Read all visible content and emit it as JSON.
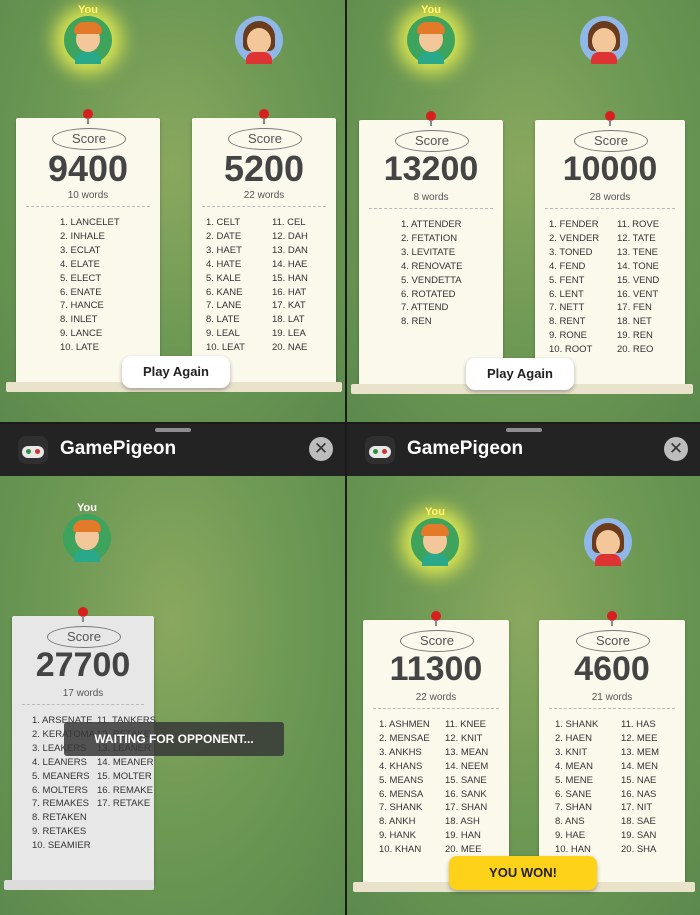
{
  "you_label": "You",
  "panels": [
    {
      "left": {
        "score_label": "Score",
        "score": "9400",
        "words": "10 words",
        "col1": [
          "1. LANCELET",
          "2. INHALE",
          "3. ECLAT",
          "4. ELATE",
          "5. ELECT",
          "6. ENATE",
          "7. HANCE",
          "8. INLET",
          "9. LANCE",
          "10. LATE"
        ]
      },
      "right": {
        "score_label": "Score",
        "score": "5200",
        "words": "22 words",
        "col1": [
          "1. CELT",
          "2. DATE",
          "3. HAET",
          "4. HATE",
          "5. KALE",
          "6. KANE",
          "7. LANE",
          "8. LATE",
          "9. LEAL",
          "10. LEAT"
        ],
        "col2": [
          "11. CEL",
          "12. DAH",
          "13. DAN",
          "14. HAE",
          "15. HAN",
          "16. HAT",
          "17. KAT",
          "18. LAT",
          "19. LEA",
          "20. NAE"
        ]
      },
      "button": "Play Again"
    },
    {
      "left": {
        "score_label": "Score",
        "score": "13200",
        "words": "8 words",
        "col1": [
          "1. ATTENDER",
          "2. FETATION",
          "3. LEVITATE",
          "4. RENOVATE",
          "5. VENDETTA",
          "6. ROTATED",
          "7. ATTEND",
          "8. REN"
        ]
      },
      "right": {
        "score_label": "Score",
        "score": "10000",
        "words": "28 words",
        "col1": [
          "1. FENDER",
          "2. VENDER",
          "3. TONED",
          "4. FEND",
          "5. FENT",
          "6. LENT",
          "7. NETT",
          "8. RENT",
          "9. RONE",
          "10. ROOT"
        ],
        "col2": [
          "11. ROVE",
          "12. TATE",
          "13. TENE",
          "14. TONE",
          "15. VEND",
          "16. VENT",
          "17. FEN",
          "18. NET",
          "19. REN",
          "20. REO"
        ]
      },
      "button": "Play Again"
    },
    {
      "header": {
        "title": "GamePigeon",
        "close": "✕"
      },
      "left": {
        "score_label": "Score",
        "score": "27700",
        "words": "17 words",
        "col1": [
          "1. ARSENATE",
          "2. KERATOMA",
          "3. LEAKERS",
          "4. LEANERS",
          "5. MEANERS",
          "6. MOLTERS",
          "7. REMAKES",
          "8. RETAKEN",
          "9. RETAKES",
          "10. SEAMIER"
        ],
        "col2": [
          "11. TANKERS",
          "12. RETAKE",
          "13. LEANER",
          "14. MEANER",
          "15. MOLTER",
          "16. REMAKE",
          "17. RETAKE"
        ]
      },
      "overlay": "WAITING FOR OPPONENT..."
    },
    {
      "header": {
        "title": "GamePigeon",
        "close": "✕"
      },
      "left": {
        "score_label": "Score",
        "score": "11300",
        "words": "22 words",
        "col1": [
          "1. ASHMEN",
          "2. MENSAE",
          "3. ANKHS",
          "4. KHANS",
          "5. MEANS",
          "6. MENSA",
          "7. SHANK",
          "8. ANKH",
          "9. HANK",
          "10. KHAN"
        ],
        "col2": [
          "11. KNEE",
          "12. KNIT",
          "13. MEAN",
          "14. NEEM",
          "15. SANE",
          "16. SANK",
          "17. SHAN",
          "18. ASH",
          "19. HAN",
          "20. MEE"
        ]
      },
      "right": {
        "score_label": "Score",
        "score": "4600",
        "words": "21 words",
        "col1": [
          "1. SHANK",
          "2. HAEN",
          "3. KNIT",
          "4. MEAN",
          "5. MENE",
          "6. SANE",
          "7. SHAN",
          "8. ANS",
          "9. HAE",
          "10. HAN"
        ],
        "col2": [
          "11. HAS",
          "12. MEE",
          "13. MEM",
          "14. MEN",
          "15. NAE",
          "16. NAS",
          "17. NIT",
          "18. SAE",
          "19. SAN",
          "20. SHA"
        ]
      },
      "button": "YOU WON!"
    }
  ],
  "colors": {
    "pin": "#d81e1e",
    "won_button": "#ffd21a",
    "background": "#6f9a55"
  }
}
